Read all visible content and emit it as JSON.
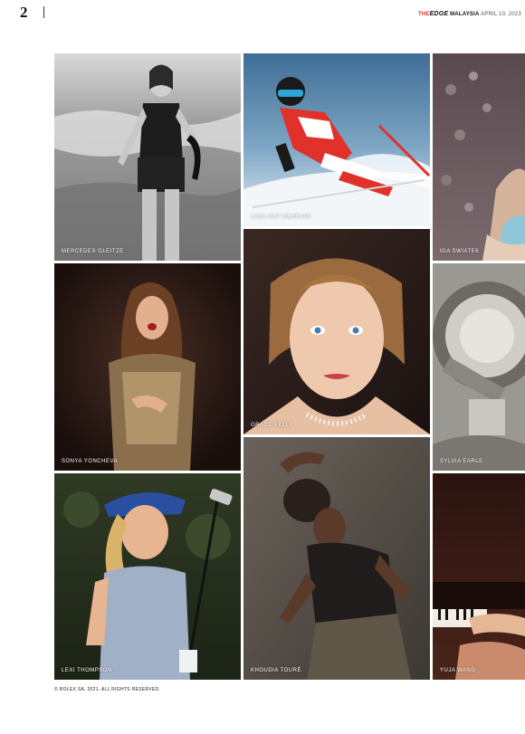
{
  "page": {
    "number": "2"
  },
  "masthead": {
    "the": "THE",
    "edge": "EDGE",
    "country": "MALAYSIA",
    "date": "APRIL 10, 2023"
  },
  "photos": [
    {
      "caption": "MERCEDES GLEITZE"
    },
    {
      "caption": "LARA GUT-BEHRAMI"
    },
    {
      "caption": "IGA SWIATEK"
    },
    {
      "caption": "SONYA YONCHEVA"
    },
    {
      "caption": "GRACE KELLY"
    },
    {
      "caption": "SYLVIA EARLE"
    },
    {
      "caption": "LEXI THOMPSON"
    },
    {
      "caption": "KHOUDIA TOURÉ"
    },
    {
      "caption": "YUJA WANG"
    }
  ],
  "credit": "© ROLEX SA, 2021. ALL RIGHTS RESERVED."
}
